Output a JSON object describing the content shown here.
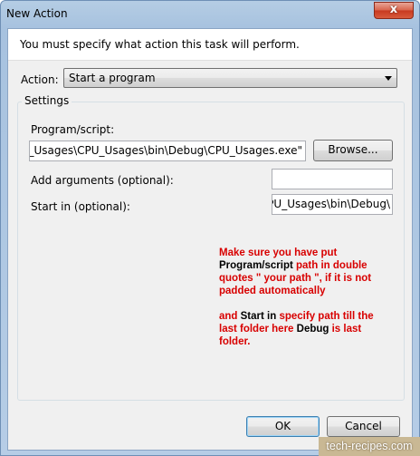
{
  "window": {
    "title": "New Action",
    "close_glyph": "x"
  },
  "header": {
    "text": "You must specify what action this task will perform."
  },
  "action": {
    "label": "Action:",
    "selected": "Start a program"
  },
  "settings": {
    "legend": "Settings",
    "program_label": "Program/script:",
    "program_value": "s\\CPU_Usages\\CPU_Usages\\bin\\Debug\\CPU_Usages.exe\"",
    "browse_label": "Browse...",
    "args_label": "Add arguments (optional):",
    "args_value": "",
    "startin_label": "Start in (optional):",
    "startin_value": "CPU_Usages\\bin\\Debug\\"
  },
  "note": {
    "p1_a": "Make sure you have put ",
    "p1_k": "Program/script",
    "p1_b": " path in double quotes \" your path \", if it is not padded automatically",
    "p2_a": "and ",
    "p2_k1": "Start",
    "p2_b": " in ",
    "p2_c": "specify path till the last folder here ",
    "p2_k2": "Debug",
    "p2_d": " is last folder."
  },
  "footer": {
    "ok_label": "OK",
    "cancel_label": "Cancel"
  },
  "watermark": "tech-recipes.com",
  "colors": {
    "note_red": "#d80000",
    "title_bar": "#b5cde4",
    "close_button": "#c7391f"
  }
}
